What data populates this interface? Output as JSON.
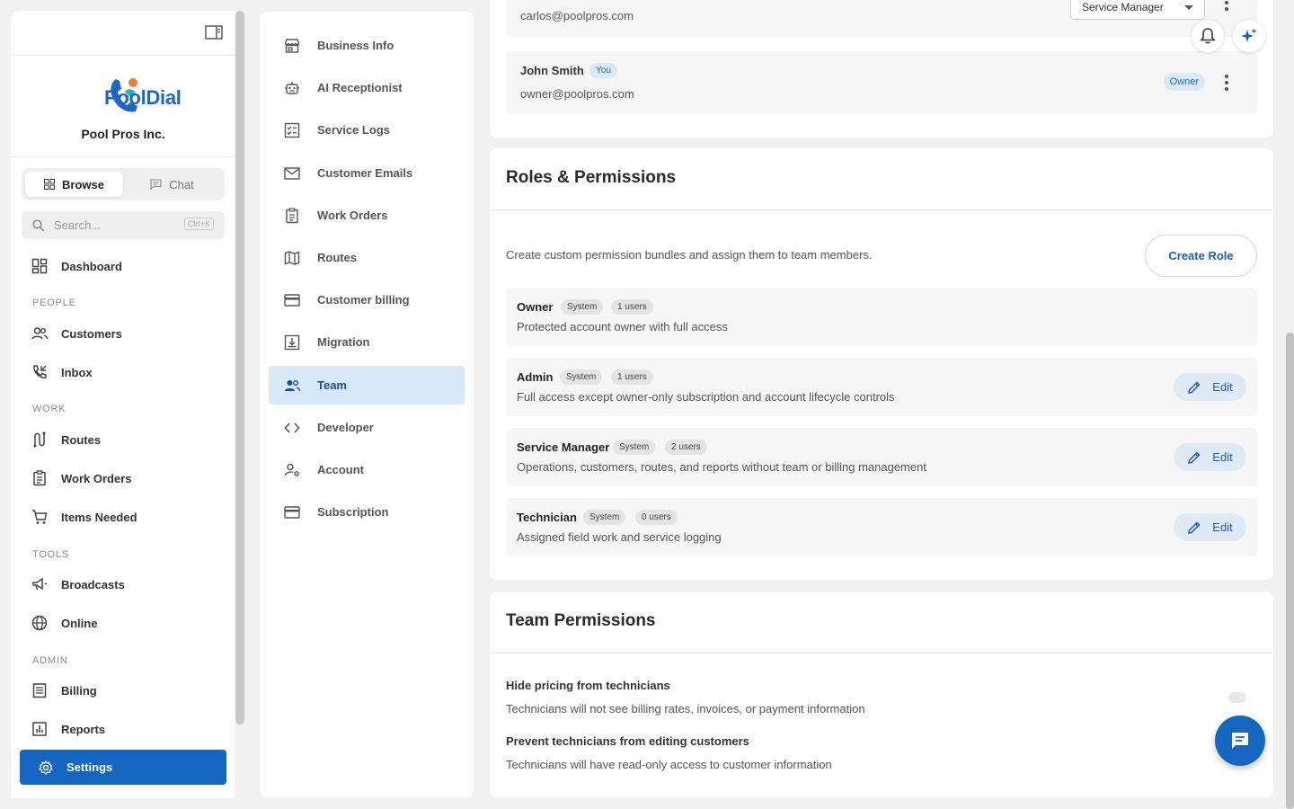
{
  "brand": {
    "logo_text": "PoolDial",
    "company": "Pool Pros Inc."
  },
  "modes": {
    "browse": "Browse",
    "chat": "Chat"
  },
  "search": {
    "placeholder": "Search...",
    "shortcut": "Ctrl+K"
  },
  "sidebar": {
    "dashboard": "Dashboard",
    "people_label": "PEOPLE",
    "customers": "Customers",
    "inbox": "Inbox",
    "work_label": "WORK",
    "routes": "Routes",
    "work_orders": "Work Orders",
    "items_needed": "Items Needed",
    "tools_label": "TOOLS",
    "broadcasts": "Broadcasts",
    "online": "Online",
    "admin_label": "ADMIN",
    "billing": "Billing",
    "reports": "Reports",
    "settings": "Settings"
  },
  "settings_nav": [
    "Business Info",
    "AI Receptionist",
    "Service Logs",
    "Customer Emails",
    "Work Orders",
    "Routes",
    "Customer billing",
    "Migration",
    "Team",
    "Developer",
    "Account",
    "Subscription"
  ],
  "team_members": [
    {
      "email": "carlos@poolpros.com",
      "role_select": "Service Manager"
    },
    {
      "name": "John Smith",
      "tag": "You",
      "email": "owner@poolpros.com",
      "role": "Owner"
    }
  ],
  "roles_section": {
    "title": "Roles & Permissions",
    "description": "Create custom permission bundles and assign them to team members.",
    "create_button": "Create Role",
    "edit_label": "Edit",
    "roles": [
      {
        "name": "Owner",
        "system": "System",
        "users": "1 users",
        "description": "Protected account owner with full access"
      },
      {
        "name": "Admin",
        "system": "System",
        "users": "1 users",
        "description": "Full access except owner-only subscription and account lifecycle controls"
      },
      {
        "name": "Service Manager",
        "system": "System",
        "users": "2 users",
        "description": "Operations, customers, routes, and reports without team or billing management"
      },
      {
        "name": "Technician",
        "system": "System",
        "users": "0 users",
        "description": "Assigned field work and service logging"
      }
    ]
  },
  "team_permissions": {
    "title": "Team Permissions",
    "items": [
      {
        "title": "Hide pricing from technicians",
        "description": "Technicians will not see billing rates, invoices, or payment information",
        "enabled": false
      },
      {
        "title": "Prevent technicians from editing customers",
        "description": "Technicians will have read-only access to customer information",
        "enabled": false
      }
    ]
  },
  "colors": {
    "accent": "#1566c0",
    "active_subnav": "#d7e8f8",
    "logo_orange": "#f27b3a",
    "logo_teal": "#2bb5a8"
  }
}
